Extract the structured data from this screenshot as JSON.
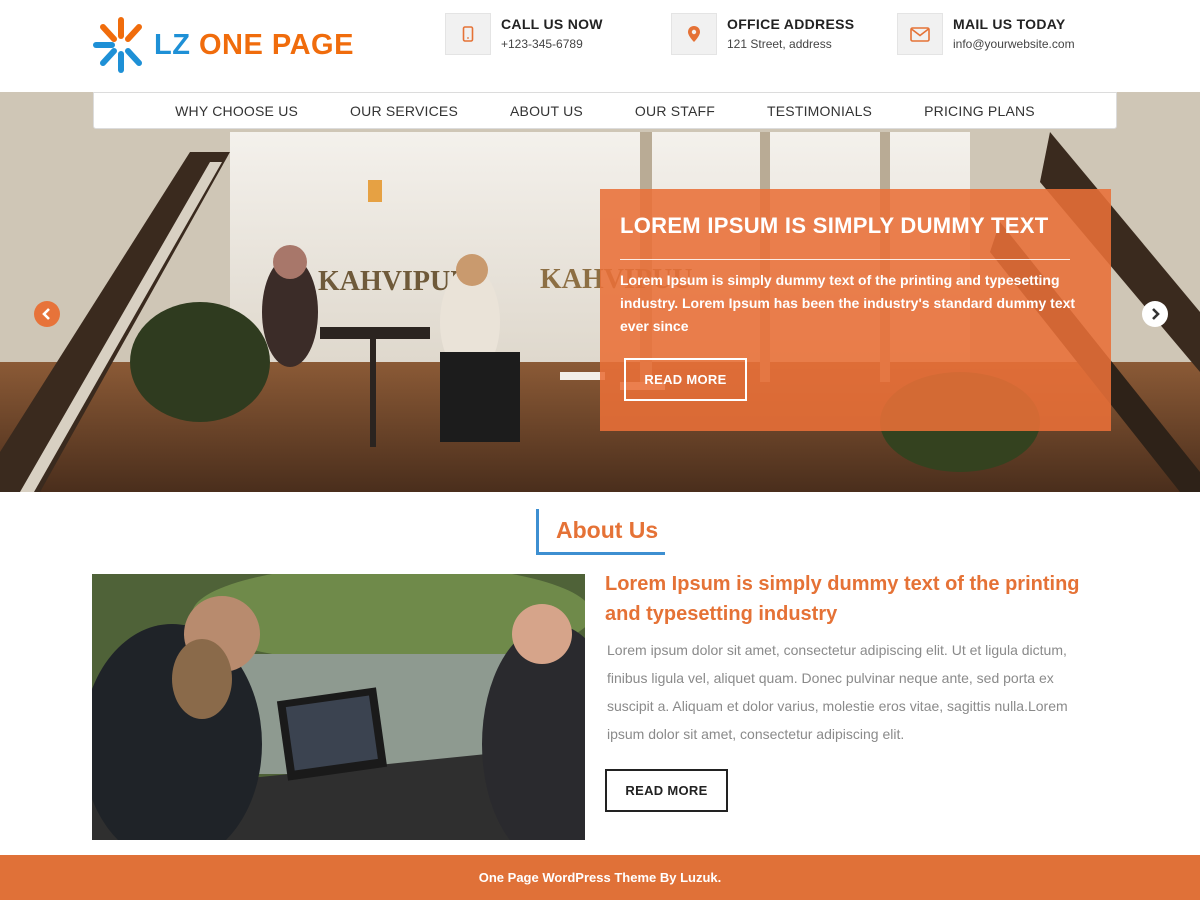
{
  "logo": {
    "part1": "LZ",
    "part2": "ONE PAGE"
  },
  "contacts": [
    {
      "icon": "phone-icon",
      "title": "CALL US NOW",
      "value": "+123-345-6789"
    },
    {
      "icon": "map-pin-icon",
      "title": "OFFICE ADDRESS",
      "value": "121 Street, address"
    },
    {
      "icon": "mail-icon",
      "title": "MAIL US TODAY",
      "value": "info@yourwebsite.com"
    }
  ],
  "nav": [
    "WHY CHOOSE US",
    "OUR SERVICES",
    "ABOUT US",
    "OUR STAFF",
    "TESTIMONIALS",
    "PRICING PLANS"
  ],
  "hero": {
    "sign_left": "KAHVIPUU",
    "sign_right": "KAHVIPUU",
    "title": "LOREM IPSUM IS SIMPLY DUMMY TEXT",
    "text": "Lorem Ipsum is simply dummy text of the printing and typesetting industry. Lorem Ipsum has been the industry's standard dummy text ever since",
    "button": "READ MORE"
  },
  "about": {
    "heading": "About Us",
    "title": "Lorem Ipsum is simply dummy text of the printing and typesetting industry",
    "text": "Lorem ipsum dolor sit amet, consectetur adipiscing elit. Ut et ligula dictum, finibus ligula vel, aliquet quam. Donec pulvinar neque ante, sed porta ex suscipit a. Aliquam et dolor varius, molestie eros vitae, sagittis nulla.Lorem ipsum dolor sit amet, consectetur adipiscing elit.",
    "button": "READ MORE"
  },
  "footer": {
    "text": "One Page WordPress Theme By Luzuk."
  },
  "colors": {
    "accent": "#e57236",
    "brand_blue": "#1e90d6",
    "brand_orange": "#f06c0c"
  }
}
